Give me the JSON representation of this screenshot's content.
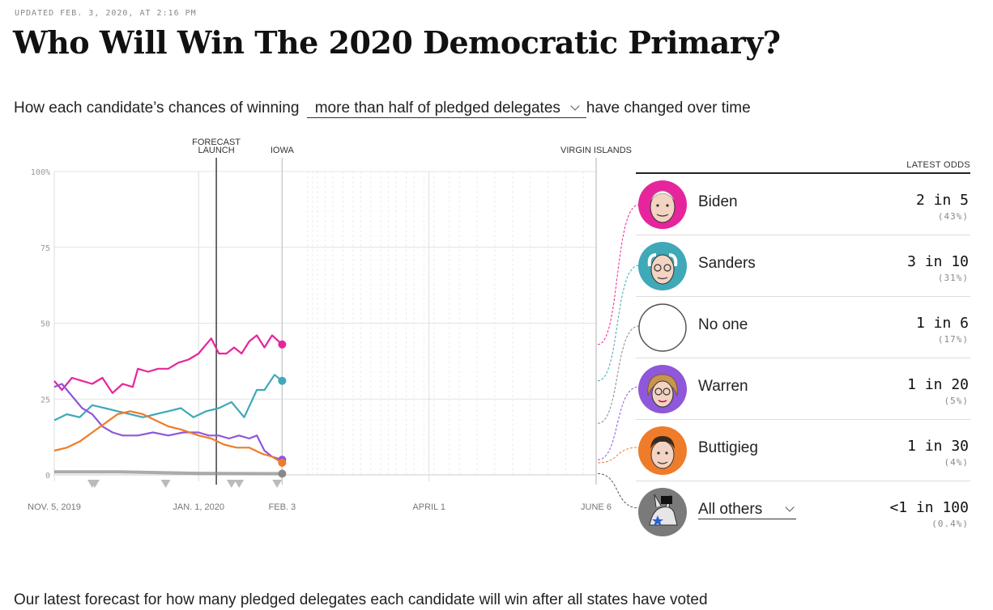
{
  "header": {
    "updated": "UPDATED FEB. 3, 2020, AT 2:16 PM",
    "title": "Who Will Win The 2020 Democratic Primary?",
    "sub_before": "How each candidate’s chances of winning",
    "selector": "more than half of pledged delegates",
    "sub_after": "have changed over time"
  },
  "legend": {
    "header": "LATEST ODDS",
    "rows": [
      {
        "name": "Biden",
        "odds": "2 in 5",
        "pct": "(43%)",
        "color": "#e6259c",
        "icon": "biden-avatar-icon"
      },
      {
        "name": "Sanders",
        "odds": "3 in 10",
        "pct": "(31%)",
        "color": "#3fa9b8",
        "icon": "sanders-avatar-icon"
      },
      {
        "name": "No one",
        "odds": "1 in 6",
        "pct": "(17%)",
        "color": "#888888",
        "icon": "empty-circle-icon"
      },
      {
        "name": "Warren",
        "odds": "1 in 20",
        "pct": "(5%)",
        "color": "#8f57d9",
        "icon": "warren-avatar-icon"
      },
      {
        "name": "Buttigieg",
        "odds": "1 in 30",
        "pct": "(4%)",
        "color": "#ef7c2a",
        "icon": "buttigieg-avatar-icon"
      },
      {
        "name": "All others",
        "odds": "<1 in 100",
        "pct": "(0.4%)",
        "color": "#555555",
        "icon": "donkey-avatar-icon"
      }
    ]
  },
  "footer": {
    "text": "Our latest forecast for how many pledged delegates each candidate will win after all states have voted"
  },
  "chart_data": {
    "type": "line",
    "y_ticks": [
      "100%",
      "75",
      "50",
      "25",
      "0"
    ],
    "ylim": [
      0,
      100
    ],
    "x_domain": [
      "2019-11-05",
      "2020-06-06"
    ],
    "x_tick_labels": [
      {
        "date": "2019-11-05",
        "label": "NOV. 5, 2019"
      },
      {
        "date": "2020-01-01",
        "label": "JAN. 1, 2020"
      },
      {
        "date": "2020-02-03",
        "label": "FEB. 3"
      },
      {
        "date": "2020-04-01",
        "label": "APRIL 1"
      },
      {
        "date": "2020-06-06",
        "label": "JUNE 6"
      }
    ],
    "events": [
      {
        "date": "2020-01-08",
        "label": [
          "FORECAST",
          "LAUNCH"
        ]
      },
      {
        "date": "2020-02-03",
        "label": [
          "IOWA"
        ]
      },
      {
        "date": "2020-06-06",
        "label": [
          "VIRGIN ISLANDS"
        ]
      }
    ],
    "debate_markers": [
      "2019-11-20",
      "2019-11-21",
      "2019-12-19",
      "2020-01-14",
      "2020-01-17",
      "2020-02-01"
    ],
    "series": [
      {
        "name": "Biden",
        "color": "#e6259c",
        "values": [
          [
            "2019-11-05",
            31
          ],
          [
            "2019-11-08",
            28
          ],
          [
            "2019-11-12",
            32
          ],
          [
            "2019-11-16",
            31
          ],
          [
            "2019-11-20",
            30
          ],
          [
            "2019-11-24",
            32
          ],
          [
            "2019-11-28",
            27
          ],
          [
            "2019-12-02",
            30
          ],
          [
            "2019-12-06",
            29
          ],
          [
            "2019-12-08",
            35
          ],
          [
            "2019-12-12",
            34
          ],
          [
            "2019-12-16",
            35
          ],
          [
            "2019-12-20",
            35
          ],
          [
            "2019-12-24",
            37
          ],
          [
            "2019-12-28",
            38
          ],
          [
            "2020-01-01",
            40
          ],
          [
            "2020-01-03",
            42
          ],
          [
            "2020-01-06",
            45
          ],
          [
            "2020-01-09",
            40
          ],
          [
            "2020-01-12",
            40
          ],
          [
            "2020-01-15",
            42
          ],
          [
            "2020-01-18",
            40
          ],
          [
            "2020-01-21",
            44
          ],
          [
            "2020-01-24",
            46
          ],
          [
            "2020-01-27",
            42
          ],
          [
            "2020-01-30",
            46
          ],
          [
            "2020-02-03",
            43
          ]
        ]
      },
      {
        "name": "Sanders",
        "color": "#3fa9b8",
        "values": [
          [
            "2019-11-05",
            18
          ],
          [
            "2019-11-10",
            20
          ],
          [
            "2019-11-15",
            19
          ],
          [
            "2019-11-20",
            23
          ],
          [
            "2019-11-25",
            22
          ],
          [
            "2019-11-30",
            21
          ],
          [
            "2019-12-05",
            20
          ],
          [
            "2019-12-10",
            19
          ],
          [
            "2019-12-15",
            20
          ],
          [
            "2019-12-20",
            21
          ],
          [
            "2019-12-25",
            22
          ],
          [
            "2019-12-30",
            19
          ],
          [
            "2020-01-04",
            21
          ],
          [
            "2020-01-09",
            22
          ],
          [
            "2020-01-14",
            24
          ],
          [
            "2020-01-19",
            19
          ],
          [
            "2020-01-24",
            28
          ],
          [
            "2020-01-27",
            28
          ],
          [
            "2020-01-31",
            33
          ],
          [
            "2020-02-03",
            31
          ]
        ]
      },
      {
        "name": "Warren",
        "color": "#8f57d9",
        "values": [
          [
            "2019-11-05",
            29
          ],
          [
            "2019-11-08",
            30
          ],
          [
            "2019-11-12",
            26
          ],
          [
            "2019-11-16",
            22
          ],
          [
            "2019-11-20",
            20
          ],
          [
            "2019-11-24",
            16
          ],
          [
            "2019-11-28",
            14
          ],
          [
            "2019-12-02",
            13
          ],
          [
            "2019-12-08",
            13
          ],
          [
            "2019-12-14",
            14
          ],
          [
            "2019-12-20",
            13
          ],
          [
            "2019-12-26",
            14
          ],
          [
            "2020-01-01",
            14
          ],
          [
            "2020-01-05",
            13
          ],
          [
            "2020-01-09",
            13
          ],
          [
            "2020-01-13",
            12
          ],
          [
            "2020-01-17",
            13
          ],
          [
            "2020-01-21",
            12
          ],
          [
            "2020-01-24",
            13
          ],
          [
            "2020-01-27",
            8
          ],
          [
            "2020-01-30",
            6
          ],
          [
            "2020-02-03",
            5
          ]
        ]
      },
      {
        "name": "Buttigieg",
        "color": "#ef7c2a",
        "values": [
          [
            "2019-11-05",
            8
          ],
          [
            "2019-11-10",
            9
          ],
          [
            "2019-11-15",
            11
          ],
          [
            "2019-11-20",
            14
          ],
          [
            "2019-11-25",
            17
          ],
          [
            "2019-11-30",
            20
          ],
          [
            "2019-12-05",
            21
          ],
          [
            "2019-12-10",
            20
          ],
          [
            "2019-12-15",
            18
          ],
          [
            "2019-12-20",
            16
          ],
          [
            "2019-12-25",
            15
          ],
          [
            "2020-01-01",
            13
          ],
          [
            "2020-01-06",
            12
          ],
          [
            "2020-01-11",
            10
          ],
          [
            "2020-01-16",
            9
          ],
          [
            "2020-01-21",
            9
          ],
          [
            "2020-01-26",
            7
          ],
          [
            "2020-01-30",
            6
          ],
          [
            "2020-02-03",
            4
          ]
        ]
      },
      {
        "name": "All others",
        "color": "#888888",
        "values": [
          [
            "2019-11-05",
            1
          ],
          [
            "2019-12-01",
            1
          ],
          [
            "2020-01-01",
            0.5
          ],
          [
            "2020-02-03",
            0.4
          ]
        ]
      }
    ]
  }
}
